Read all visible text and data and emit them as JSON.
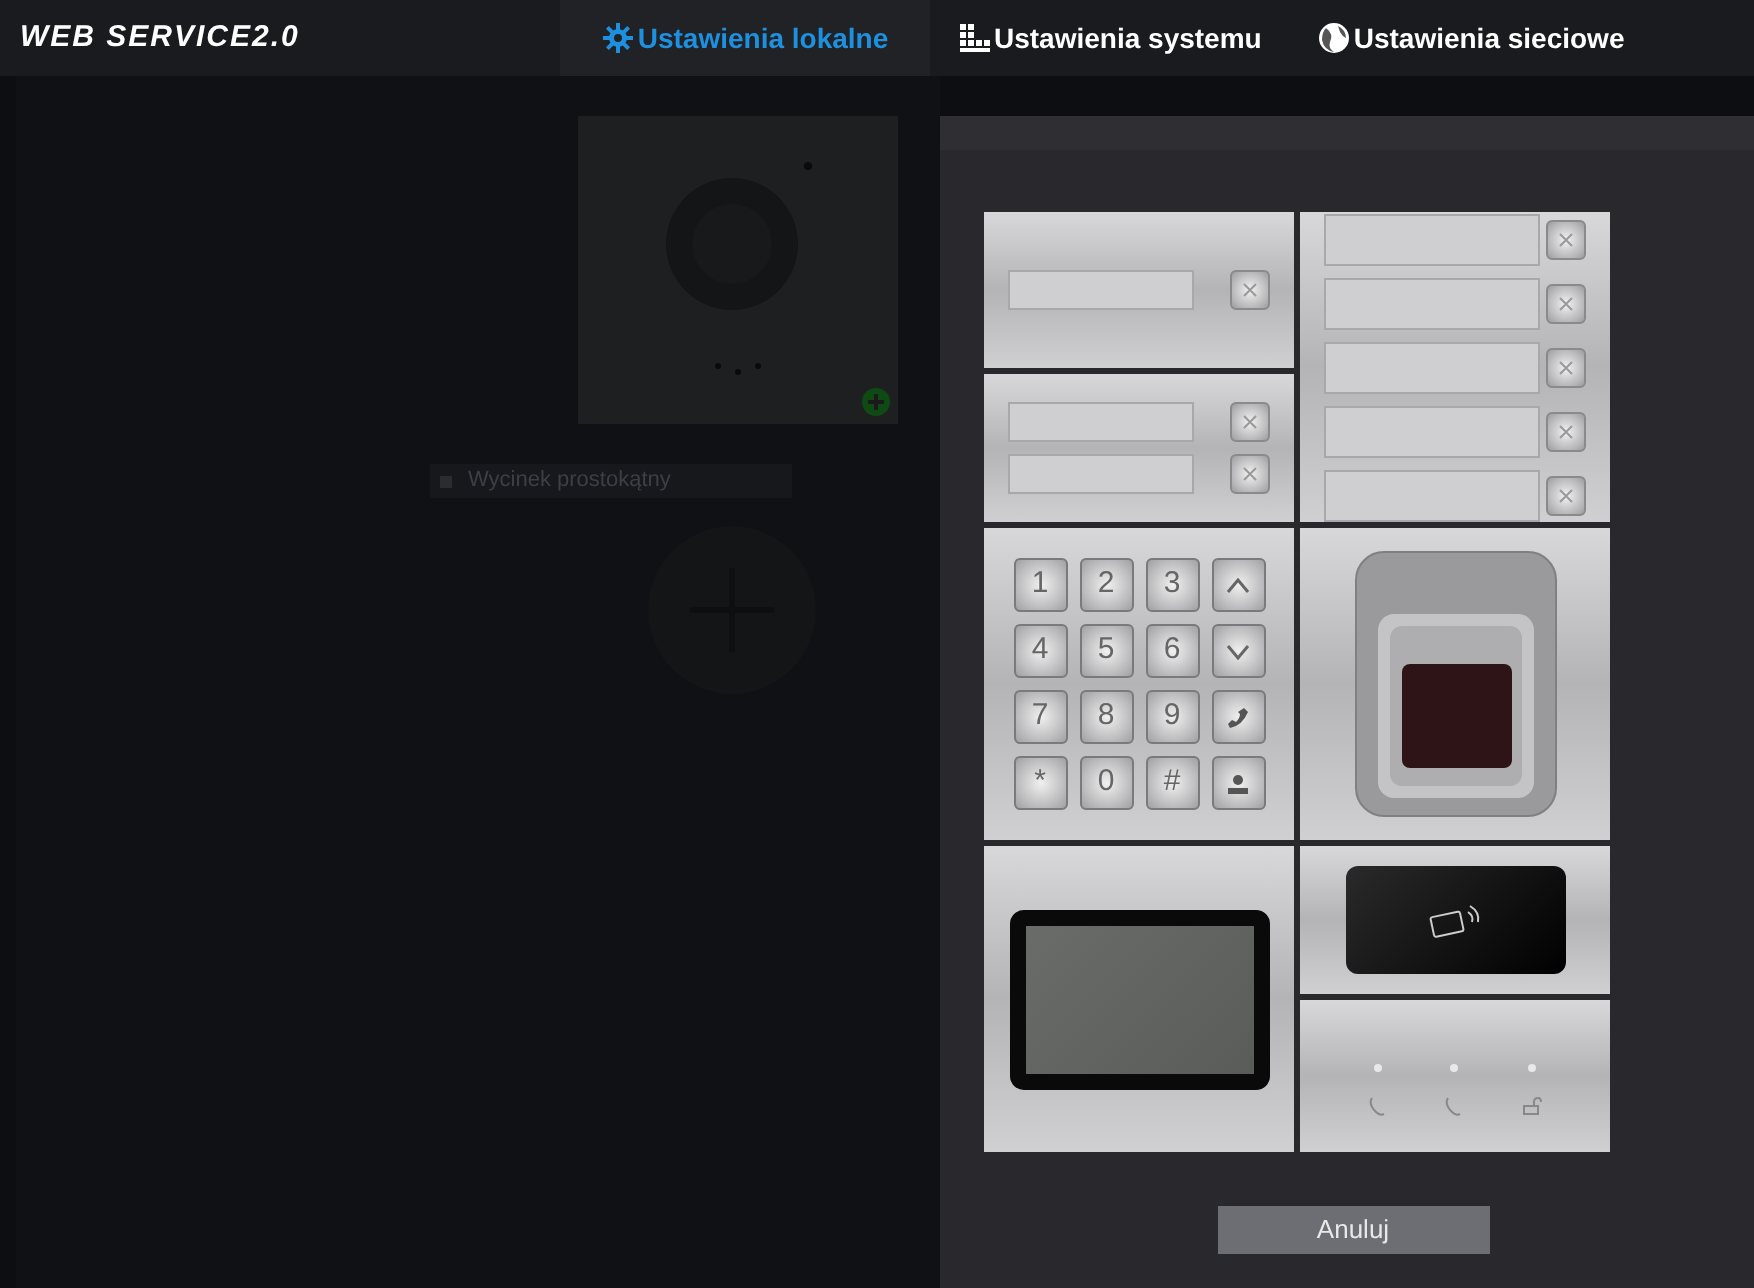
{
  "header": {
    "logo": "WEB SERVICE2.0",
    "tabs": [
      {
        "label": "Ustawienia lokalne",
        "selected": true
      },
      {
        "label": "Ustawienia systemu",
        "selected": false
      },
      {
        "label": "Ustawienia sieciowe",
        "selected": false
      }
    ]
  },
  "background": {
    "field_label": "Wycinek prostokątny"
  },
  "modules": [
    {
      "kind": "single_name_plate"
    },
    {
      "kind": "five_name_plate"
    },
    {
      "kind": "double_name_plate"
    },
    {
      "kind": "keypad",
      "keys": [
        "1",
        "2",
        "3",
        "4",
        "5",
        "6",
        "7",
        "8",
        "9",
        "*",
        "0",
        "#"
      ]
    },
    {
      "kind": "fingerprint"
    },
    {
      "kind": "display"
    },
    {
      "kind": "card_reader"
    },
    {
      "kind": "indicator"
    }
  ],
  "cancel_button": "Anuluj"
}
